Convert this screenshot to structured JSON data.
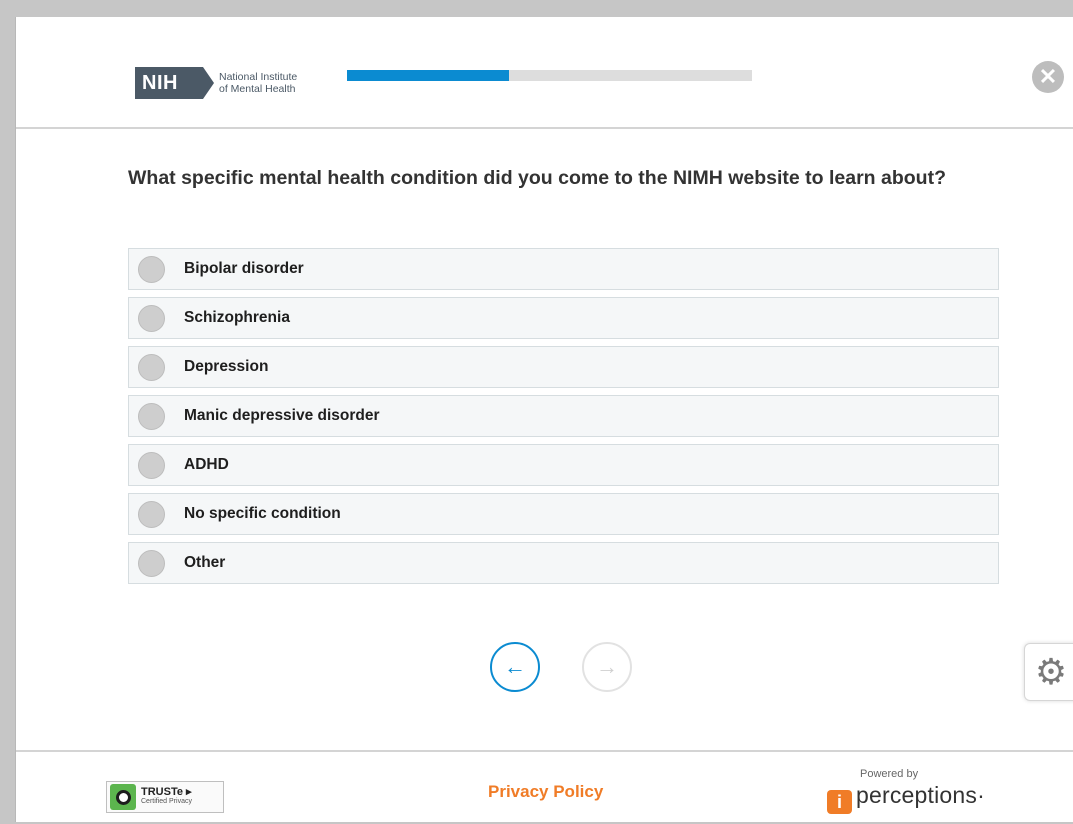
{
  "header": {
    "logo_abbr": "NIH",
    "logo_line1": "National Institute",
    "logo_line2": "of Mental Health",
    "progress_fraction": 0.4,
    "close_glyph": "✕"
  },
  "question": {
    "text": "What specific mental health condition did you come to the NIMH website to learn about?"
  },
  "options": [
    {
      "label": "Bipolar disorder"
    },
    {
      "label": "Schizophrenia"
    },
    {
      "label": "Depression"
    },
    {
      "label": "Manic depressive disorder"
    },
    {
      "label": "ADHD"
    },
    {
      "label": "No specific condition"
    },
    {
      "label": "Other"
    }
  ],
  "navigation": {
    "back_glyph": "←",
    "next_glyph": "→"
  },
  "settings": {
    "glyph": "⚙"
  },
  "footer": {
    "truste_title": "TRUSTe ▸",
    "truste_sub": "Certified Privacy",
    "privacy_link": "Privacy Policy",
    "powered_by": "Powered by",
    "brand_icon": "i",
    "brand_name": "perceptions·"
  },
  "colors": {
    "accent": "#0b8bd1",
    "link": "#f07c27"
  }
}
